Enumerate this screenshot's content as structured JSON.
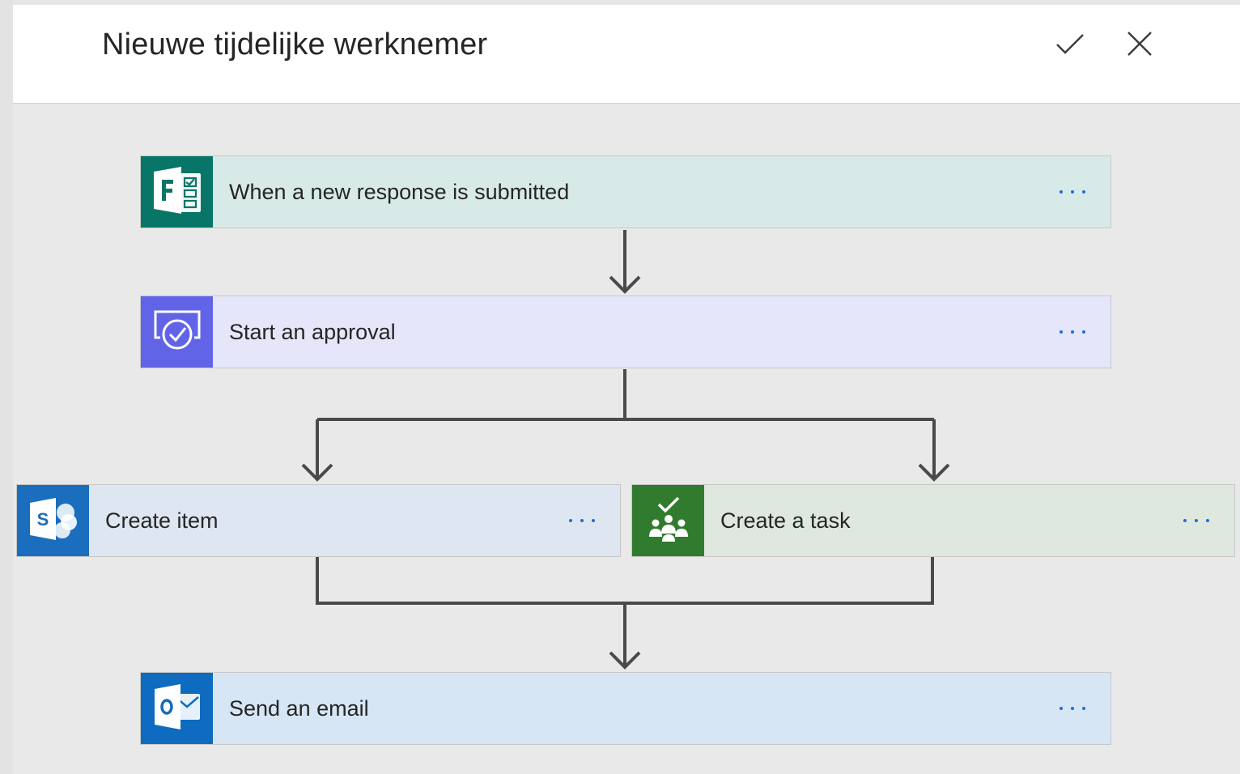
{
  "window": {
    "title": "Nieuwe tijdelijke werknemer"
  },
  "header_actions": [
    {
      "name": "check-icon"
    },
    {
      "name": "close-icon"
    }
  ],
  "steps": {
    "trigger": {
      "label": "When a new response is submitted",
      "icon": "forms-icon",
      "icon_bg": "#077568",
      "card_bg": "#d8eae7"
    },
    "approval": {
      "label": "Start an approval",
      "icon": "approvals-icon",
      "icon_bg": "#6264e8",
      "card_bg": "#e6e6fa"
    },
    "create_item": {
      "label": "Create item",
      "icon": "sharepoint-icon",
      "icon_bg": "#1b6ebd",
      "card_bg": "#dde6f1"
    },
    "create_task": {
      "label": "Create a task",
      "icon": "planner-icon",
      "icon_bg": "#317b2e",
      "card_bg": "#dfe8de"
    },
    "send_email": {
      "label": "Send an email",
      "icon": "outlook-icon",
      "icon_bg": "#0f6bc0",
      "card_bg": "#d6e6f4"
    }
  },
  "colors": {
    "more_dots": "#1e6fd1",
    "connector": "#4a4a4a"
  }
}
